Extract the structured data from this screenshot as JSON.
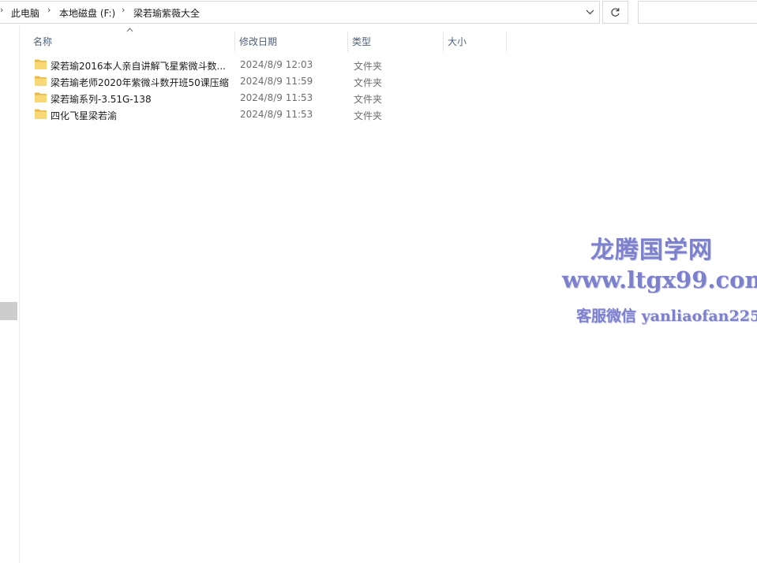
{
  "breadcrumbs": [
    "此电脑",
    "本地磁盘 (F:)",
    "梁若瑜紫薇大全"
  ],
  "search": {
    "value": "",
    "placeholder": ""
  },
  "columns": {
    "name": "名称",
    "modified": "修改日期",
    "type": "类型",
    "size": "大小"
  },
  "files": [
    {
      "name": "梁若瑜2016本人亲自讲解飞星紫微斗数...",
      "modified": "2024/8/9 12:03",
      "type": "文件夹",
      "size": ""
    },
    {
      "name": "梁若瑜老师2020年紫微斗数开班50课压缩",
      "modified": "2024/8/9 11:59",
      "type": "文件夹",
      "size": ""
    },
    {
      "name": "梁若瑜系列-3.51G-138",
      "modified": "2024/8/9 11:53",
      "type": "文件夹",
      "size": ""
    },
    {
      "name": "四化飞星梁若渝",
      "modified": "2024/8/9 11:53",
      "type": "文件夹",
      "size": ""
    }
  ],
  "watermark": {
    "line1": "龙腾国学网",
    "line2": "www.ltgx99.com",
    "line3": "客服微信 yanliaofan225"
  },
  "icons": {
    "breadcrumb_separator": "chevron-right-icon",
    "dropdown": "chevron-down-icon",
    "refresh": "refresh-icon",
    "folder": "folder-icon",
    "sort": "sort-up-icon"
  },
  "colors": {
    "folder_fill": "#f8d775",
    "folder_tab": "#e8b94a",
    "header_text": "#4c607a",
    "watermark": "#7377c8"
  }
}
